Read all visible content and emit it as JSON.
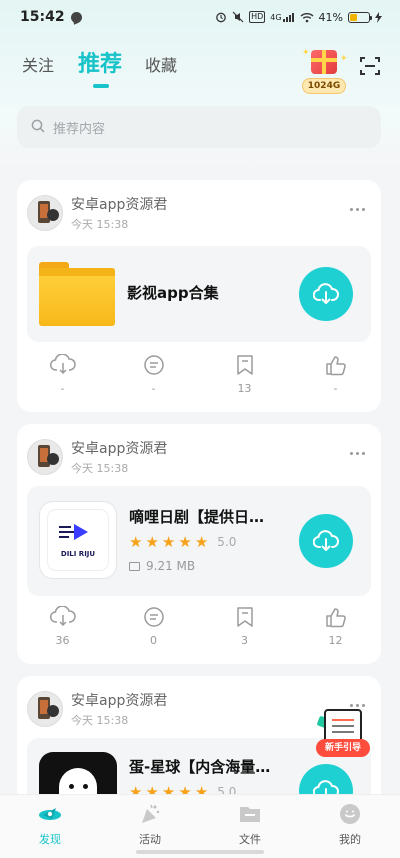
{
  "status_bar": {
    "time": "15:42",
    "network": "4G",
    "hd": "HD",
    "battery_text": "41%",
    "battery_level": 0.41
  },
  "top_tabs": [
    {
      "label": "关注",
      "active": false
    },
    {
      "label": "推荐",
      "active": true
    },
    {
      "label": "收藏",
      "active": false
    }
  ],
  "gift_badge": {
    "label": "1024G"
  },
  "search": {
    "placeholder": "推荐内容"
  },
  "feed": [
    {
      "author": "安卓app资源君",
      "time": "今天 15:38",
      "item": {
        "title": "影视app合集",
        "icon": "folder-icon"
      },
      "stats": [
        "-",
        "-",
        "13",
        "-"
      ]
    },
    {
      "author": "安卓app资源君",
      "time": "今天 15:38",
      "item": {
        "title": "嘀哩日剧【提供日…",
        "icon_text": "DILI RIJU",
        "rating": "5.0",
        "stars": 5,
        "size": "9.21 MB"
      },
      "stats": [
        "36",
        "0",
        "3",
        "12"
      ]
    },
    {
      "author": "安卓app资源君",
      "time": "今天 15:38",
      "item": {
        "title": "蛋-星球【内含海量…",
        "rating": "5.0",
        "stars": 5
      }
    }
  ],
  "guide_badge": {
    "label": "新手引导"
  },
  "bottom_nav": [
    {
      "label": "发现",
      "icon": "discover-icon",
      "active": true
    },
    {
      "label": "活动",
      "icon": "party-popper-icon",
      "active": false
    },
    {
      "label": "文件",
      "icon": "folder-icon",
      "active": false
    },
    {
      "label": "我的",
      "icon": "profile-icon",
      "active": false
    }
  ],
  "colors": {
    "accent": "#17c3c8",
    "download_button": "#1fd0d3",
    "star": "#f7a21b"
  }
}
